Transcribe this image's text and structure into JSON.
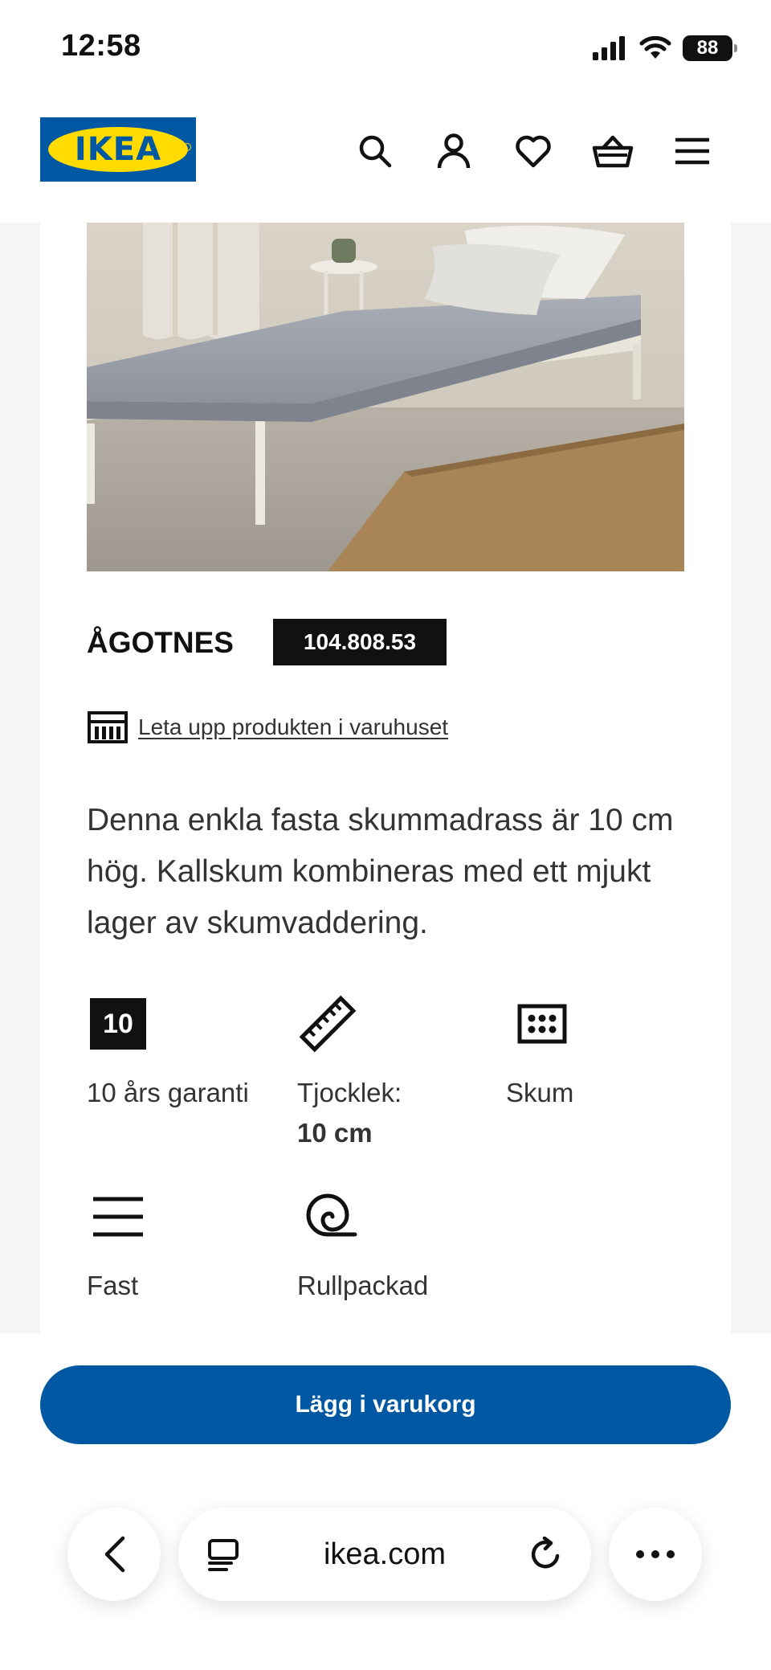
{
  "status_bar": {
    "time": "12:58",
    "battery": "88"
  },
  "header": {
    "logo_text": "IKEA",
    "icons": [
      "search-icon",
      "account-icon",
      "heart-icon",
      "basket-icon",
      "menu-icon"
    ]
  },
  "product": {
    "name": "ÅGOTNES",
    "article_number": "104.808.53",
    "store_link": "Leta upp produkten i varuhuset",
    "description": "Denna enkla fasta skummadrass är 10 cm hög. Kallskum kombineras med ett mjukt lager av skumvaddering.",
    "features": [
      {
        "icon": "warranty-10-icon",
        "badge": "10",
        "label": "10 års garanti"
      },
      {
        "icon": "ruler-icon",
        "label": "Tjocklek:",
        "value": "10 cm"
      },
      {
        "icon": "foam-icon",
        "label": "Skum"
      },
      {
        "icon": "firm-icon",
        "label": "Fast"
      },
      {
        "icon": "rolled-icon",
        "label": "Rullpackad"
      }
    ]
  },
  "cart": {
    "button_label": "Lägg i varukorg"
  },
  "browser": {
    "address": "ikea.com"
  },
  "colors": {
    "ikea_blue": "#0058a3",
    "ikea_yellow": "#ffdb00"
  }
}
